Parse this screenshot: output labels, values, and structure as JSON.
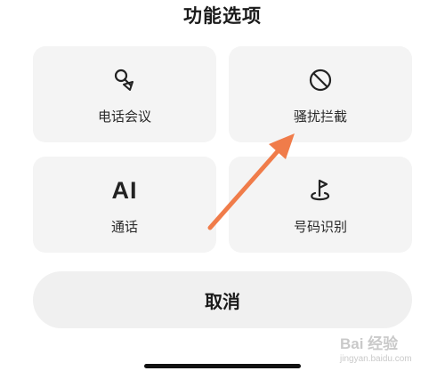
{
  "header": {
    "title": "功能选项"
  },
  "options": [
    {
      "icon": "microphone-icon",
      "label": "电话会议"
    },
    {
      "icon": "block-icon",
      "label": "骚扰拦截"
    },
    {
      "icon_text": "AI",
      "label": "通话"
    },
    {
      "icon": "location-flag-icon",
      "label": "号码识别"
    }
  ],
  "cancel": {
    "label": "取消"
  },
  "annotation": {
    "arrow_color": "#f07c4a"
  },
  "watermark": {
    "main": "Bai 经验",
    "sub": "jingyan.baidu.com"
  }
}
